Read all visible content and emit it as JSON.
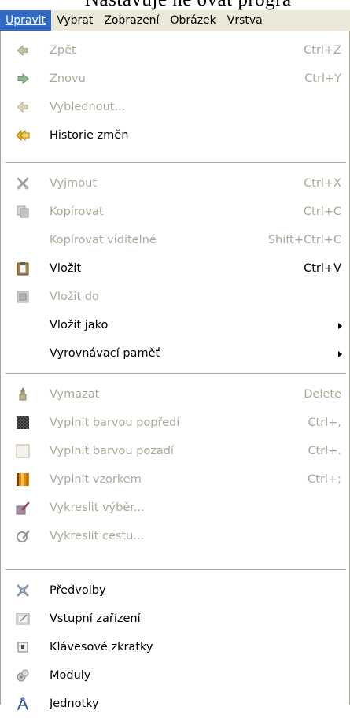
{
  "top_clipped_text": "Nastavuje ne  ovat  progra",
  "menubar": {
    "items": [
      "Upravit",
      "Vybrat",
      "Zobrazení",
      "Obrázek",
      "Vrstva"
    ],
    "active_index": 0
  },
  "menu": {
    "items": [
      {
        "label": "Zpět",
        "shortcut": "Ctrl+Z",
        "icon": "undo-icon",
        "enabled": false
      },
      {
        "label": "Znovu",
        "shortcut": "Ctrl+Y",
        "icon": "redo-icon",
        "enabled": false
      },
      {
        "label": "Vyblednout...",
        "shortcut": "",
        "icon": "fade-icon",
        "enabled": false
      },
      {
        "label": "Historie změn",
        "shortcut": "",
        "icon": "history-icon",
        "enabled": true
      },
      {
        "label": "Vyjmout",
        "shortcut": "Ctrl+X",
        "icon": "cut-icon",
        "enabled": false
      },
      {
        "label": "Kopírovat",
        "shortcut": "Ctrl+C",
        "icon": "copy-icon",
        "enabled": false
      },
      {
        "label": "Kopírovat viditelné",
        "shortcut": "Shift+Ctrl+C",
        "icon": "",
        "enabled": false
      },
      {
        "label": "Vložit",
        "shortcut": "Ctrl+V",
        "icon": "paste-icon",
        "enabled": true
      },
      {
        "label": "Vložit do",
        "shortcut": "",
        "icon": "paste-into-icon",
        "enabled": false
      },
      {
        "label": "Vložit jako",
        "shortcut": "",
        "icon": "",
        "enabled": true,
        "submenu": true
      },
      {
        "label": "Vyrovnávací paměť",
        "shortcut": "",
        "icon": "",
        "enabled": true,
        "submenu": true
      },
      {
        "label": "Vymazat",
        "shortcut": "Delete",
        "icon": "clear-icon",
        "enabled": false
      },
      {
        "label": "Vyplnit barvou popředí",
        "shortcut": "Ctrl+,",
        "icon": "fill-fg-icon",
        "enabled": false
      },
      {
        "label": "Vyplnit barvou pozadí",
        "shortcut": "Ctrl+.",
        "icon": "fill-bg-icon",
        "enabled": false
      },
      {
        "label": "Vyplnit vzorkem",
        "shortcut": "Ctrl+;",
        "icon": "fill-pattern-icon",
        "enabled": false
      },
      {
        "label": "Vykreslit výběr...",
        "shortcut": "",
        "icon": "stroke-selection-icon",
        "enabled": false
      },
      {
        "label": "Vykreslit cestu...",
        "shortcut": "",
        "icon": "stroke-path-icon",
        "enabled": false
      },
      {
        "label": "Předvolby",
        "shortcut": "",
        "icon": "preferences-icon",
        "enabled": true
      },
      {
        "label": "Vstupní zařízení",
        "shortcut": "",
        "icon": "input-devices-icon",
        "enabled": true
      },
      {
        "label": "Klávesové zkratky",
        "shortcut": "",
        "icon": "keyboard-shortcuts-icon",
        "enabled": true
      },
      {
        "label": "Moduly",
        "shortcut": "",
        "icon": "modules-icon",
        "enabled": true
      },
      {
        "label": "Jednotky",
        "shortcut": "",
        "icon": "units-icon",
        "enabled": true
      }
    ]
  },
  "colors": {
    "menubar_bg": "#ece9d8",
    "highlight": "#316ac5",
    "disabled_text": "#aca899",
    "separator": "#aca899"
  }
}
